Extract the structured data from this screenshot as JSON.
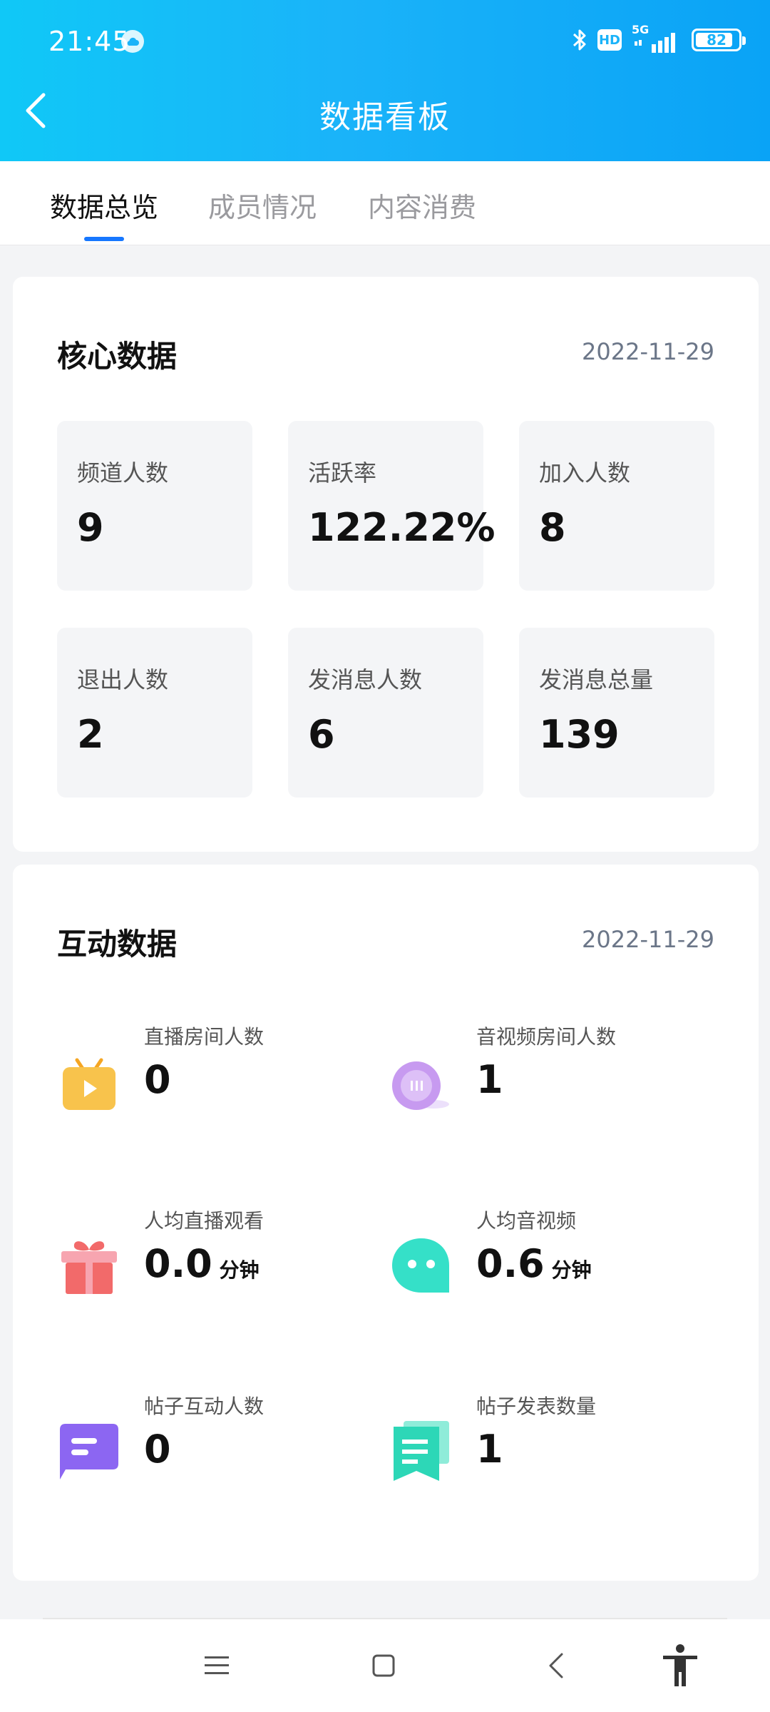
{
  "status_bar": {
    "time": "21:45",
    "hd": "HD",
    "network": "5G",
    "battery": "82"
  },
  "header": {
    "title": "数据看板"
  },
  "tabs": [
    {
      "label": "数据总览",
      "active": true
    },
    {
      "label": "成员情况",
      "active": false
    },
    {
      "label": "内容消费",
      "active": false
    }
  ],
  "core": {
    "title": "核心数据",
    "date": "2022-11-29",
    "metrics": [
      {
        "label": "频道人数",
        "value": "9"
      },
      {
        "label": "活跃率",
        "value": "122.22%"
      },
      {
        "label": "加入人数",
        "value": "8"
      },
      {
        "label": "退出人数",
        "value": "2"
      },
      {
        "label": "发消息人数",
        "value": "6"
      },
      {
        "label": "发消息总量",
        "value": "139"
      }
    ]
  },
  "interaction": {
    "title": "互动数据",
    "date": "2022-11-29",
    "stats": [
      {
        "label": "直播房间人数",
        "value": "0",
        "unit": "",
        "icon": "tv-play-icon",
        "color": "#f8c34c"
      },
      {
        "label": "音视频房间人数",
        "value": "1",
        "unit": "",
        "icon": "voice-room-icon",
        "color": "#c79af0"
      },
      {
        "label": "人均直播观看",
        "value": "0.0",
        "unit": "分钟",
        "icon": "gift-icon",
        "color": "#f26a6a"
      },
      {
        "label": "人均音视频",
        "value": "0.6",
        "unit": "分钟",
        "icon": "chat-bubble-icon",
        "color": "#35e0c8"
      },
      {
        "label": "帖子互动人数",
        "value": "0",
        "unit": "",
        "icon": "post-message-icon",
        "color": "#8c66f2"
      },
      {
        "label": "帖子发表数量",
        "value": "1",
        "unit": "",
        "icon": "document-bookmark-icon",
        "color": "#2dd7b7"
      }
    ]
  },
  "colors": {
    "header_start": "#10c8f7",
    "header_end": "#0aa3f6",
    "tab_indicator": "#1677ff"
  },
  "nav": [
    "menu-icon",
    "home-square-icon",
    "back-chevron-icon",
    "accessibility-icon"
  ]
}
